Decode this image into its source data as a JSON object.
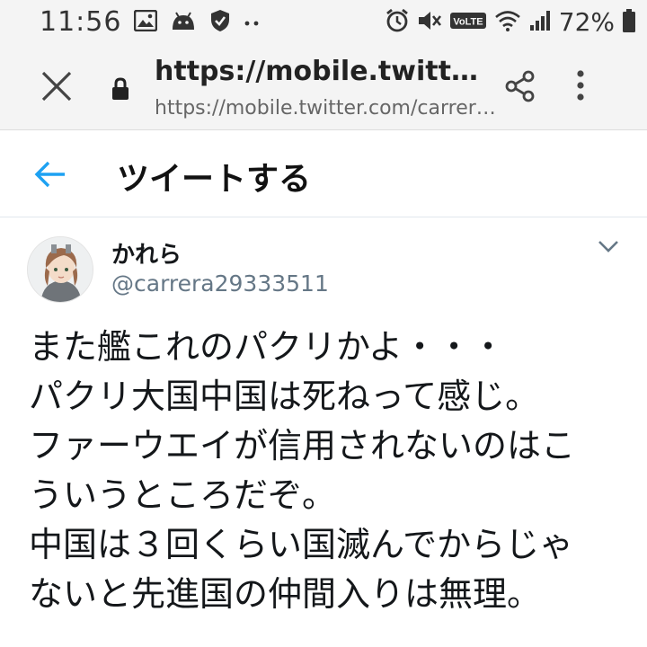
{
  "status_bar": {
    "time": "11:56",
    "battery": "72%",
    "left_icons": [
      "image-icon",
      "android-icon",
      "shield-icon",
      "more-dots-icon"
    ],
    "right_icons": [
      "alarm-icon",
      "mute-icon",
      "volte-icon",
      "wifi-icon",
      "signal-icon",
      "battery-icon"
    ],
    "volte_label": "VoLTE"
  },
  "browser": {
    "title": "https://mobile.twitter.com...",
    "url": "https://mobile.twitter.com/carrera2..."
  },
  "header": {
    "title": "ツイートする"
  },
  "tweet": {
    "user_name": "かれら",
    "user_handle": "@carrera29333511",
    "lines": [
      "また艦これのパクリかよ・・・",
      "パクリ大国中国は死ねって感じ。",
      "ファーウエイが信用されないのはこ",
      "ういうところだぞ。",
      "中国は３回くらい国滅んでからじゃ",
      "ないと先進国の仲間入りは無理。"
    ]
  },
  "colors": {
    "twitter_blue": "#1da1f2",
    "bar_bg": "#f4f4f4",
    "text_primary": "#14171a",
    "text_secondary": "#657786"
  }
}
